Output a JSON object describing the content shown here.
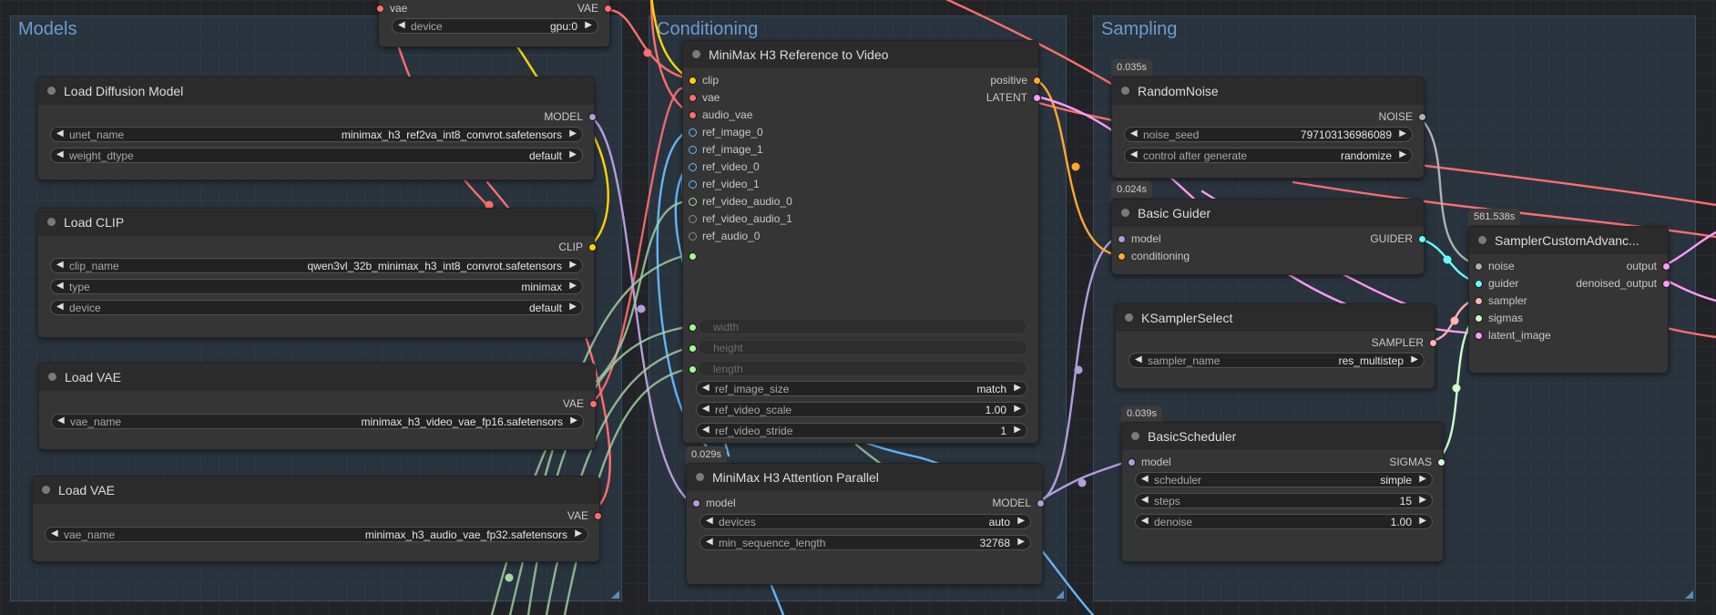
{
  "groups": {
    "models": "Models",
    "conditioning": "Conditioning",
    "sampling": "Sampling"
  },
  "nodes": {
    "vae_device": {
      "vae_label": "vae",
      "vae_out": "VAE",
      "device": {
        "label": "device",
        "value": "gpu:0"
      }
    },
    "load_diffusion": {
      "title": "Load Diffusion Model",
      "output": "MODEL",
      "unet_name": {
        "label": "unet_name",
        "value": "minimax_h3_ref2va_int8_convrot.safetensors"
      },
      "weight_dtype": {
        "label": "weight_dtype",
        "value": "default"
      }
    },
    "load_clip": {
      "title": "Load CLIP",
      "output": "CLIP",
      "clip_name": {
        "label": "clip_name",
        "value": "qwen3vl_32b_minimax_h3_int8_convrot.safetensors"
      },
      "type": {
        "label": "type",
        "value": "minimax"
      },
      "device": {
        "label": "device",
        "value": "default"
      }
    },
    "load_vae_1": {
      "title": "Load VAE",
      "output": "VAE",
      "vae_name": {
        "label": "vae_name",
        "value": "minimax_h3_video_vae_fp16.safetensors"
      }
    },
    "load_vae_2": {
      "title": "Load VAE",
      "output": "VAE",
      "vae_name": {
        "label": "vae_name",
        "value": "minimax_h3_audio_vae_fp32.safetensors"
      }
    },
    "ref_to_video": {
      "title": "MiniMax H3 Reference to Video",
      "inputs": [
        "clip",
        "vae",
        "audio_vae",
        "ref_image_0",
        "ref_image_1",
        "ref_video_0",
        "ref_video_1",
        "ref_video_audio_0",
        "ref_video_audio_1",
        "ref_audio_0"
      ],
      "outputs": [
        "positive",
        "LATENT"
      ],
      "width_label": "width",
      "height_label": "height",
      "length_label": "length",
      "ref_image_size": {
        "label": "ref_image_size",
        "value": "match"
      },
      "ref_video_scale": {
        "label": "ref_video_scale",
        "value": "1.00"
      },
      "ref_video_stride": {
        "label": "ref_video_stride",
        "value": "1"
      }
    },
    "attention_parallel": {
      "timing": "0.029s",
      "title": "MiniMax H3 Attention Parallel",
      "input": "model",
      "output": "MODEL",
      "devices": {
        "label": "devices",
        "value": "auto"
      },
      "min_sequence_length": {
        "label": "min_sequence_length",
        "value": "32768"
      }
    },
    "random_noise": {
      "timing": "0.035s",
      "title": "RandomNoise",
      "output": "NOISE",
      "noise_seed": {
        "label": "noise_seed",
        "value": "797103136986089"
      },
      "control_after_generate": {
        "label": "control after generate",
        "value": "randomize"
      }
    },
    "basic_guider": {
      "timing": "0.024s",
      "title": "Basic Guider",
      "inputs": [
        "model",
        "conditioning"
      ],
      "output": "GUIDER"
    },
    "ksampler_select": {
      "title": "KSamplerSelect",
      "output": "SAMPLER",
      "sampler_name": {
        "label": "sampler_name",
        "value": "res_multistep"
      }
    },
    "basic_scheduler": {
      "timing": "0.039s",
      "title": "BasicScheduler",
      "input": "model",
      "output": "SIGMAS",
      "scheduler": {
        "label": "scheduler",
        "value": "simple"
      },
      "steps": {
        "label": "steps",
        "value": "15"
      },
      "denoise": {
        "label": "denoise",
        "value": "1.00"
      }
    },
    "sampler_custom": {
      "timing": "581.538s",
      "title": "SamplerCustomAdvanc...",
      "inputs": [
        "noise",
        "guider",
        "sampler",
        "sigmas",
        "latent_image"
      ],
      "outputs": [
        "output",
        "denoised_output"
      ]
    }
  },
  "colors": {
    "model": "#b39ddb",
    "clip": "#ffd500",
    "vae": "#ff6e6e",
    "conditioning": "#ffa931",
    "latent": "#ff9cf9",
    "image": "#64b5f6",
    "audio": "#a5d6a7",
    "noise": "#b0b0b0",
    "guider": "#66ffff",
    "sampler": "#ffb3b3",
    "sigmas": "#cdffcd",
    "int": "#a1ff8c"
  }
}
